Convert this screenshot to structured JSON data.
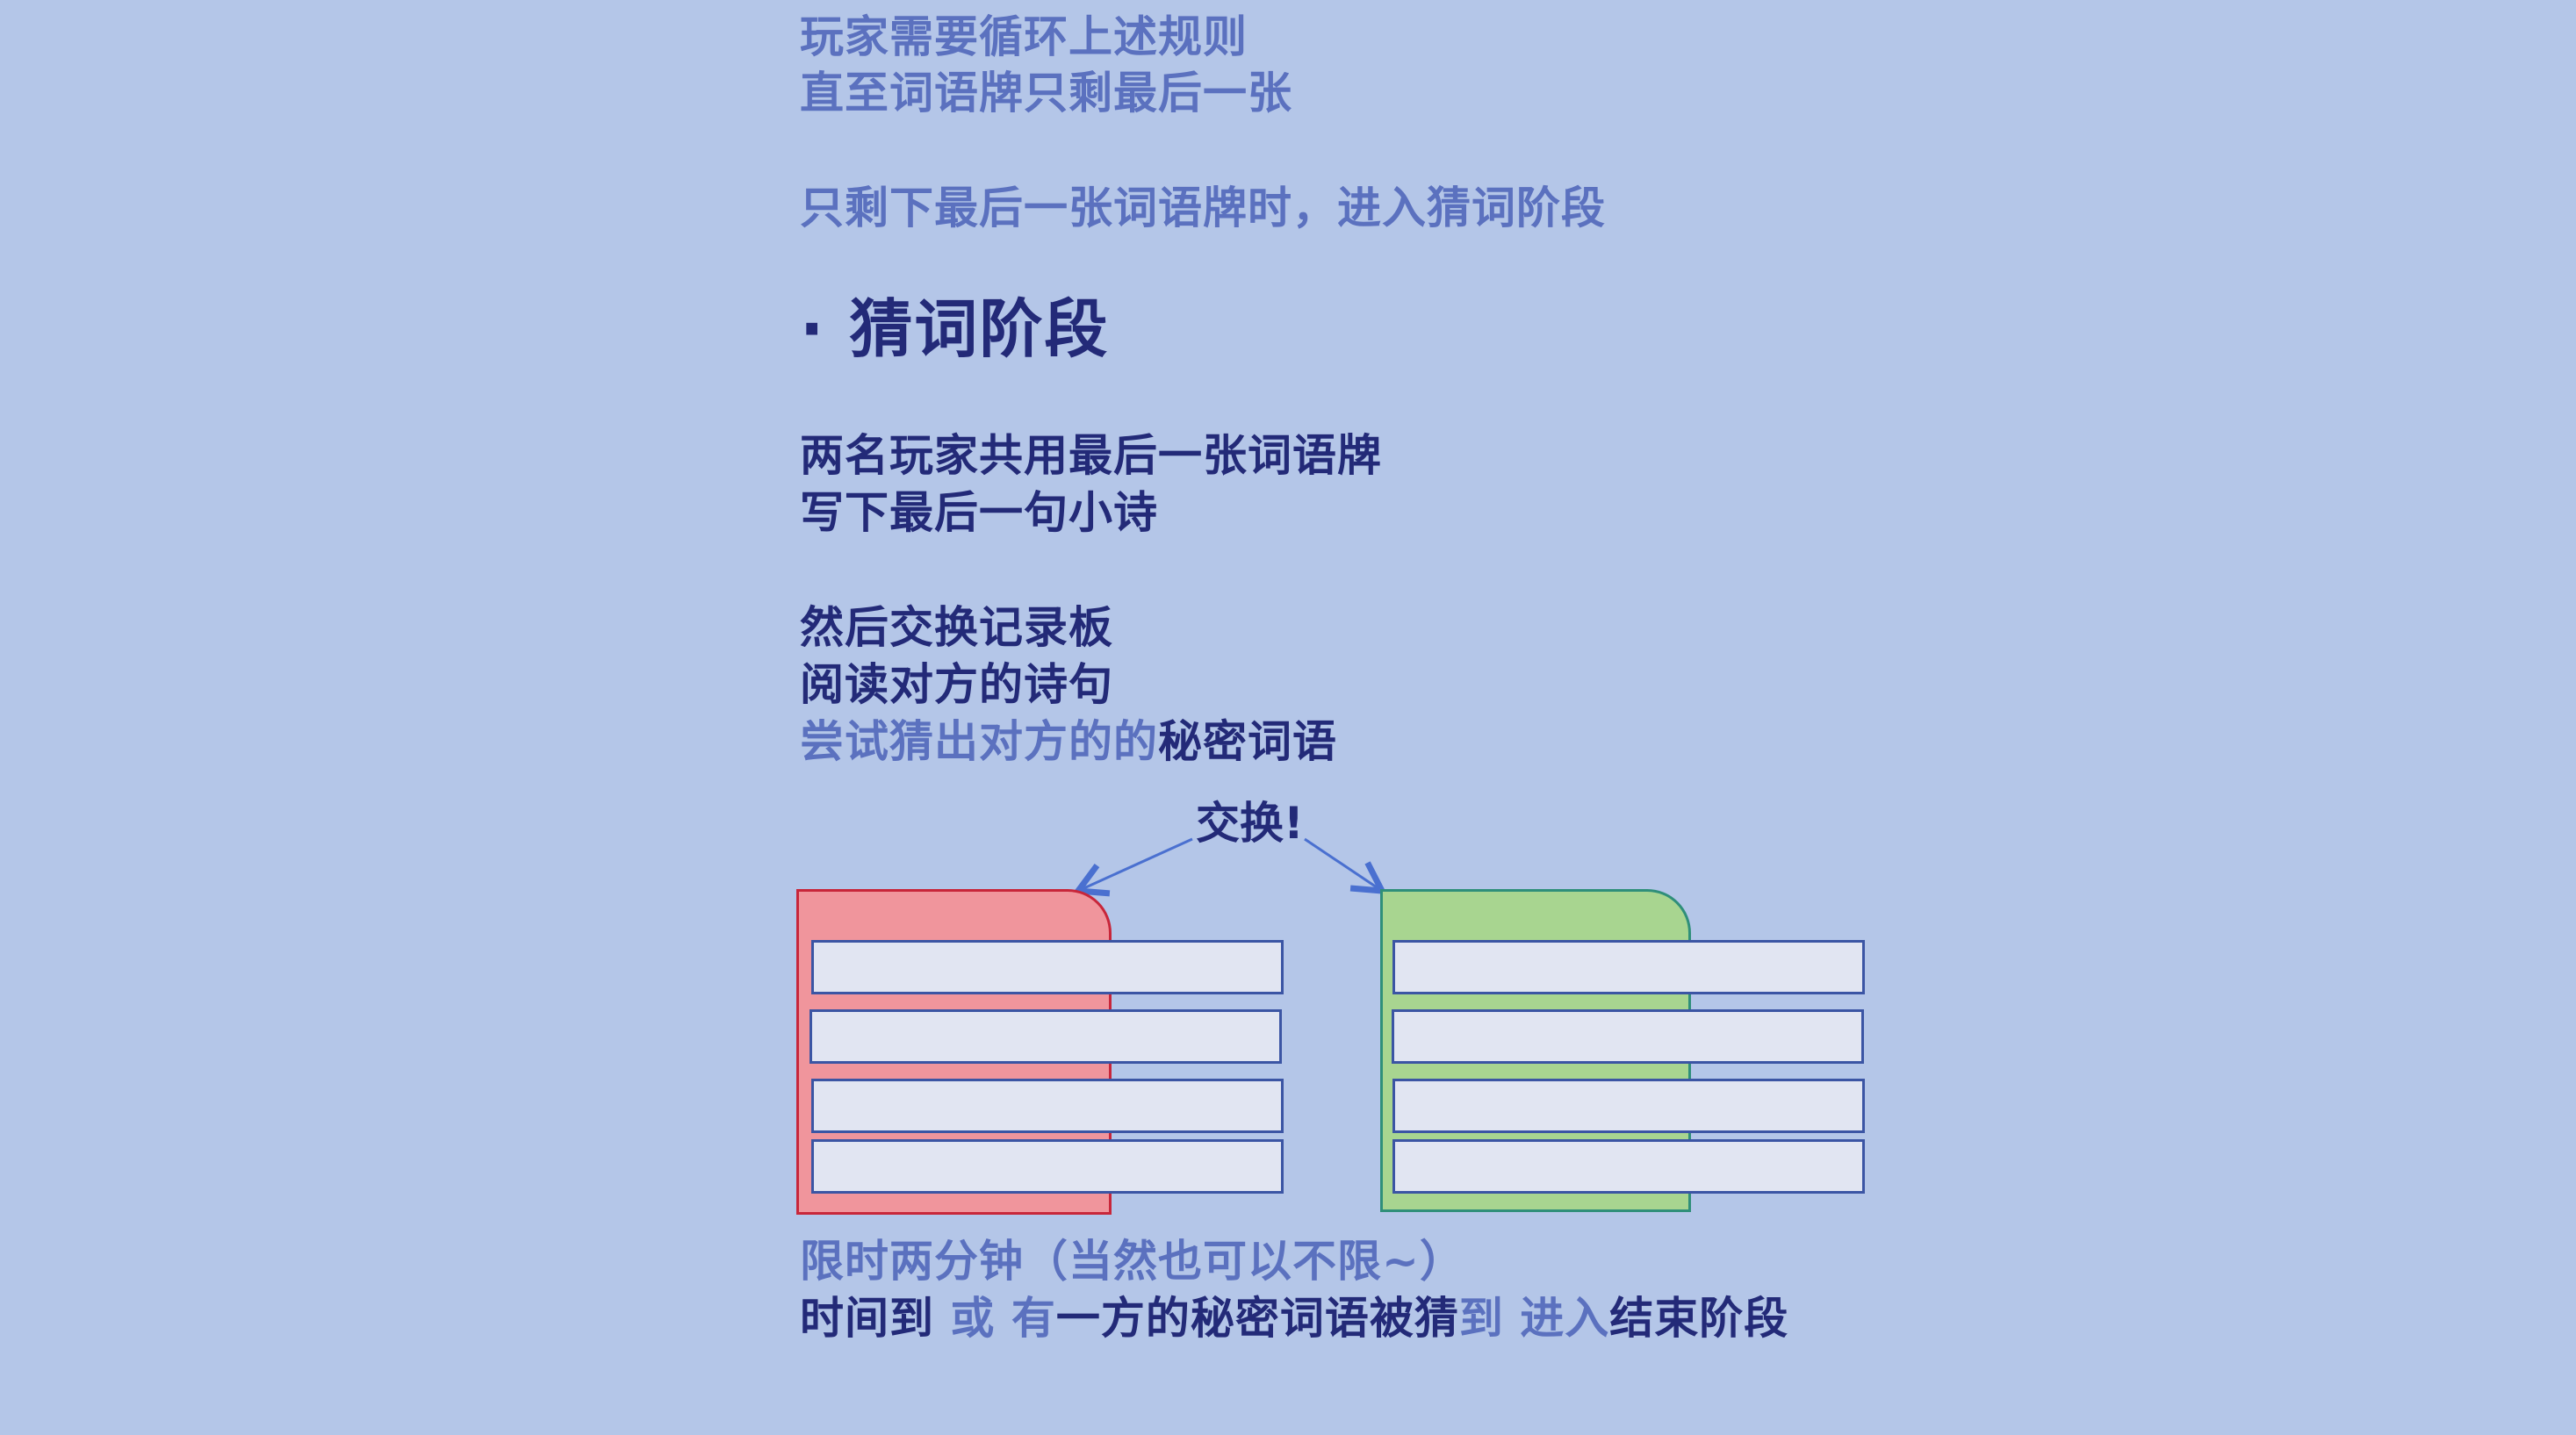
{
  "colors": {
    "background": "#b4c6e8",
    "light_text": "#5b71bf",
    "dark_text": "#232a78",
    "red_card_fill": "#f0959c",
    "red_card_border": "#c8263a",
    "green_card_fill": "#a8d590",
    "green_card_border": "#2f8f7a",
    "row_fill": "#e1e5f2",
    "row_border": "#3b55a4",
    "arrow": "#4a70d0"
  },
  "rules": {
    "loop_line_1": "玩家需要循环上述规则",
    "loop_line_2": "直至词语牌只剩最后一张",
    "transition_line": "只剩下最后一张词语牌时，进入猜词阶段"
  },
  "section": {
    "title": "· 猜词阶段"
  },
  "guess": {
    "share_line": "两名玩家共用最后一张词语牌",
    "write_line": "写下最后一句小诗",
    "swap_line": "然后交换记录板",
    "read_line": "阅读对方的诗句",
    "try_prefix": "尝试猜出对方的的",
    "try_suffix": "秘密词语"
  },
  "diagram": {
    "exchange_label": "交换!"
  },
  "footer": {
    "time_limit": "限时两分钟（当然也可以不限~）",
    "end_seg1": "时间到 ",
    "end_seg2": "或 有",
    "end_seg3": "一方的秘密词语被猜",
    "end_seg4": "到 进入",
    "end_seg5": "结束阶段"
  }
}
